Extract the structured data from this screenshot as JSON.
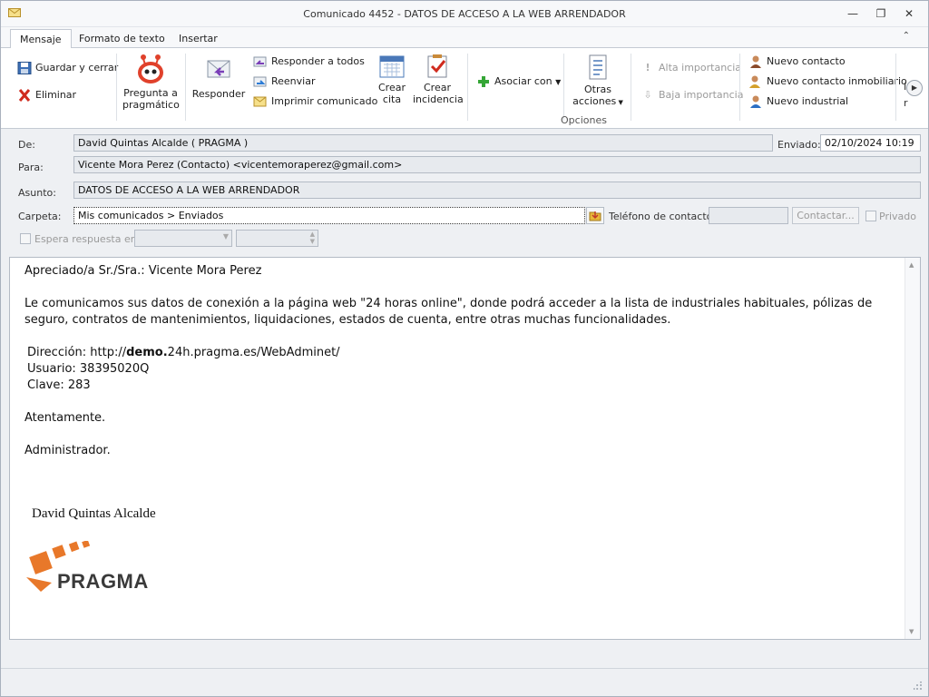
{
  "window": {
    "title": "Comunicado 4452 - DATOS DE ACCESO A LA WEB ARRENDADOR"
  },
  "tabs": [
    {
      "label": "Mensaje",
      "active": true
    },
    {
      "label": "Formato de texto",
      "active": false
    },
    {
      "label": "Insertar",
      "active": false
    }
  ],
  "ribbon": {
    "guardar": "Guardar y cerrar",
    "eliminar": "Eliminar",
    "pregunta_line1": "Pregunta a",
    "pregunta_line2": "pragmático",
    "responder": "Responder",
    "responder_todos": "Responder a todos",
    "reenviar": "Reenviar",
    "imprimir": "Imprimir comunicado",
    "crear_cita_1": "Crear",
    "crear_cita_2": "cita",
    "crear_incidencia_1": "Crear",
    "crear_incidencia_2": "incidencia",
    "asociar": "Asociar con",
    "otras_1": "Otras",
    "otras_2": "acciones",
    "alta": "Alta importancia",
    "baja": "Baja importancia",
    "nuevo_contacto": "Nuevo contacto",
    "nuevo_inmobiliario": "Nuevo contacto inmobiliario",
    "nuevo_industrial": "Nuevo industrial",
    "overflow_1": "I",
    "overflow_2": "r",
    "group_opciones": "Opciones"
  },
  "header": {
    "de_label": "De:",
    "de_value": "David Quintas Alcalde ( PRAGMA )",
    "enviado_label": "Enviado:",
    "enviado_value": "02/10/2024 10:19",
    "para_label": "Para:",
    "para_value": "Vicente Mora Perez (Contacto) <vicentemoraperez@gmail.com>",
    "asunto_label": "Asunto:",
    "asunto_value": "DATOS DE ACCESO A LA WEB ARRENDADOR",
    "carpeta_label": "Carpeta:",
    "carpeta_value": "Mis comunicados > Enviados",
    "telefono_label": "Teléfono de contacto:",
    "telefono_value": "",
    "contactar": "Contactar...",
    "privado": "Privado",
    "espera_label": "Espera respuesta en:"
  },
  "body": {
    "greeting": "Apreciado/a Sr./Sra.: Vicente Mora Perez",
    "paragraph": "Le comunicamos sus datos de conexión a la página web \"24 horas online\", donde podrá acceder a la lista de industriales habituales, pólizas de seguro, contratos de mantenimientos, liquidaciones, estados de cuenta, entre otras muchas funcionalidades.",
    "direccion_label": "Dirección: http://",
    "direccion_bold": "demo.",
    "direccion_rest": "24h.pragma.es/WebAdminet/",
    "usuario": "Usuario: 38395020Q",
    "clave": "Clave: 283",
    "closing": "Atentamente.",
    "signoff": "Administrador.",
    "signature_name": "David Quintas Alcalde",
    "logo_text": "PRAGMA"
  },
  "colors": {
    "accent_orange": "#e8782a",
    "pragma_dark": "#3a3a3a"
  }
}
